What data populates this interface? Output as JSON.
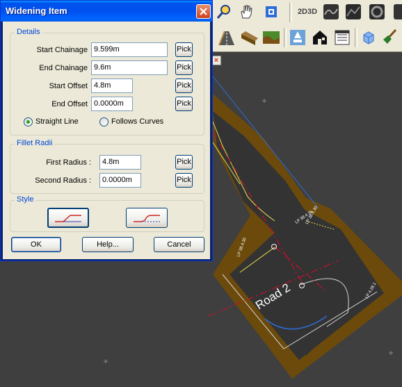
{
  "dialog": {
    "title": "Widening Item",
    "details": {
      "legend": "Details",
      "start_chainage": {
        "label": "Start Chainage",
        "value": "9.599m",
        "pick": "Pick"
      },
      "end_chainage": {
        "label": "End Chainage",
        "value": "9.6m",
        "pick": "Pick"
      },
      "start_offset": {
        "label": "Start Offset",
        "value": "4.8m",
        "pick": "Pick"
      },
      "end_offset": {
        "label": "End Offset",
        "value": "0.0000m",
        "pick": "Pick"
      },
      "straight_line": {
        "label": "Straight Line",
        "checked": true
      },
      "follows_curves": {
        "label": "Follows Curves",
        "checked": false
      }
    },
    "fillet": {
      "legend": "Fillet Radii",
      "first_radius": {
        "label": "First Radius :",
        "value": "4.8m",
        "pick": "Pick"
      },
      "second_radius": {
        "label": "Second Radius :",
        "value": "0.0000m",
        "pick": "Pick"
      }
    },
    "style": {
      "legend": "Style",
      "selected": "straight-taper"
    },
    "buttons": {
      "ok": "OK",
      "help": "Help...",
      "cancel": "Cancel"
    }
  },
  "toolbar_top": {
    "view_toggle_label": "2D3D"
  },
  "viewport": {
    "road_label": "Road 2",
    "chainage_labels": [
      "LP 38.9.30",
      "LP 38.4.35",
      "LP 38.4.30",
      "LP 4.28.1"
    ]
  },
  "colors": {
    "background": "#3f3f3f",
    "road_border": "#6b4a0c",
    "road_surface": "#333333",
    "centreline": "#c8102e",
    "edge_line": "#e8e04a",
    "alignment": "#2f6cd8",
    "xp_title_blue": "#0054e3",
    "dialog_face": "#ece9d8"
  }
}
